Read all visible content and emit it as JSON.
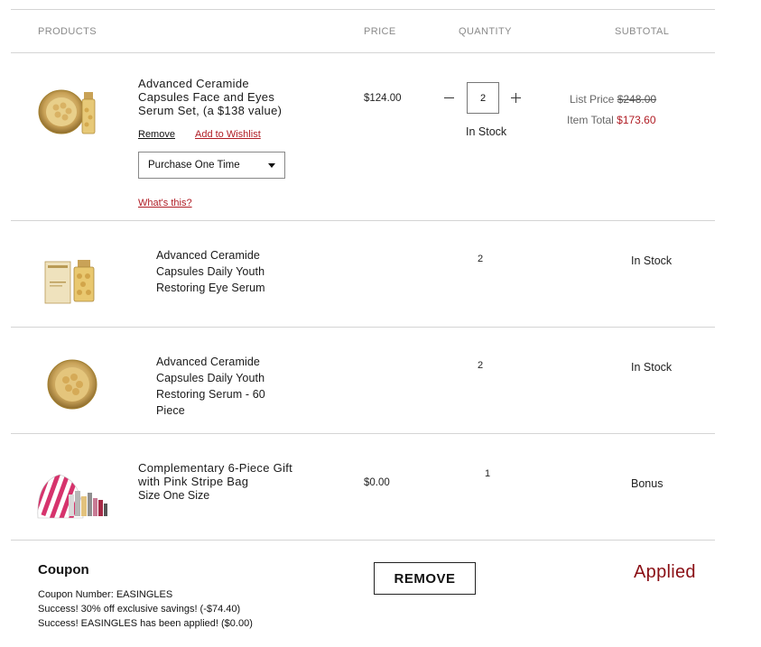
{
  "header": {
    "products": "PRODUCTS",
    "price": "PRICE",
    "quantity": "QUANTITY",
    "subtotal": "SUBTOTAL"
  },
  "items": [
    {
      "name_lines": [
        "Advanced Ceramide",
        "Capsules Face and Eyes",
        "Serum Set, (a $138 value)"
      ],
      "price": "$124.00",
      "quantity": "2",
      "stock": "In Stock",
      "remove_label": "Remove",
      "wishlist_label": "Add to Wishlist",
      "purchase_option": "Purchase One Time",
      "whats_this": "What's this?",
      "list_price_label": "List Price",
      "list_price": "$248.00",
      "item_total_label": "Item Total",
      "item_total": "$173.60"
    },
    {
      "name_lines": [
        "Advanced Ceramide",
        "Capsules Daily Youth",
        "Restoring Eye Serum"
      ],
      "quantity": "2",
      "status": "In Stock"
    },
    {
      "name_lines": [
        "Advanced Ceramide",
        "Capsules Daily Youth",
        "Restoring Serum - 60",
        "Piece"
      ],
      "quantity": "2",
      "status": "In Stock"
    },
    {
      "name_lines": [
        "Complementary 6-Piece Gift",
        "with Pink Stripe Bag"
      ],
      "size": "Size One Size",
      "price": "$0.00",
      "quantity": "1",
      "status": "Bonus"
    }
  ],
  "coupon": {
    "title": "Coupon",
    "number_line": "Coupon Number: EASINGLES",
    "success_1": "Success! 30% off exclusive savings! (-$74.40)",
    "success_2": "Success! EASINGLES has been applied! ($0.00)",
    "remove_button": "REMOVE",
    "status": "Applied"
  },
  "colors": {
    "accent_red": "#b01c24",
    "applied_red": "#8a0f15",
    "divider": "#d4d4d4"
  }
}
